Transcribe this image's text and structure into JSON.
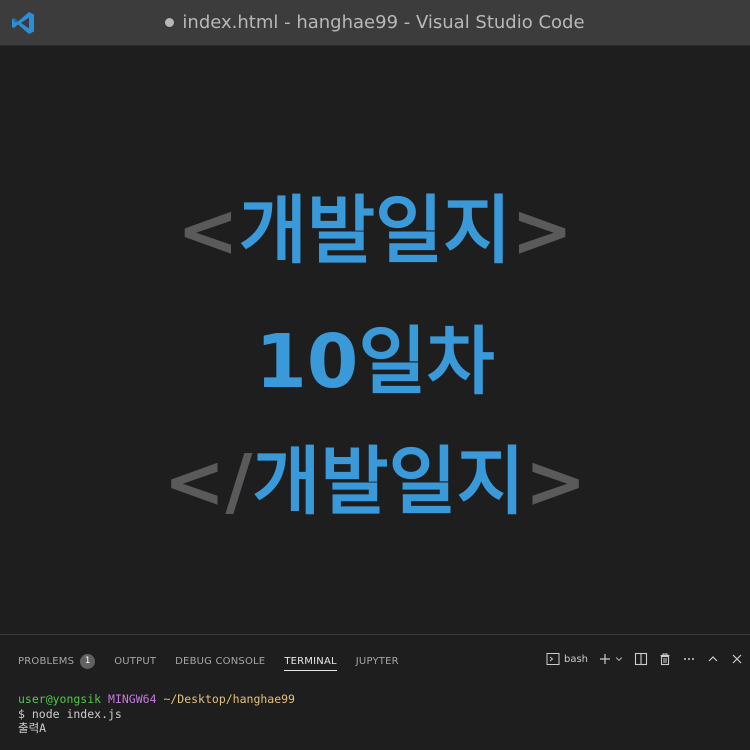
{
  "window": {
    "title": "index.html - hanghae99 - Visual Studio Code",
    "app_icon": "vscode-logo-icon"
  },
  "editor": {
    "line1": {
      "open": "<",
      "text": "개발일지",
      "close": ">"
    },
    "line2": {
      "text": "10일차"
    },
    "line3": {
      "open": "</",
      "text": "개발일지",
      "close": ">"
    }
  },
  "panel": {
    "tabs": [
      {
        "label": "PROBLEMS",
        "badge": "1"
      },
      {
        "label": "OUTPUT"
      },
      {
        "label": "DEBUG CONSOLE"
      },
      {
        "label": "TERMINAL",
        "active": true
      },
      {
        "label": "JUPYTER"
      }
    ],
    "terminal_name": "bash",
    "terminal": {
      "user": "user@yongsik",
      "host": "MINGW64",
      "path": "~/Desktop/hanghae99",
      "command": "$ node index.js",
      "output": "출력A"
    }
  },
  "colors": {
    "accent": "#3a9ad9",
    "bracket": "#5a5a5a",
    "user": "#4ec94e",
    "host": "#c678dd",
    "path": "#e5c07b"
  }
}
